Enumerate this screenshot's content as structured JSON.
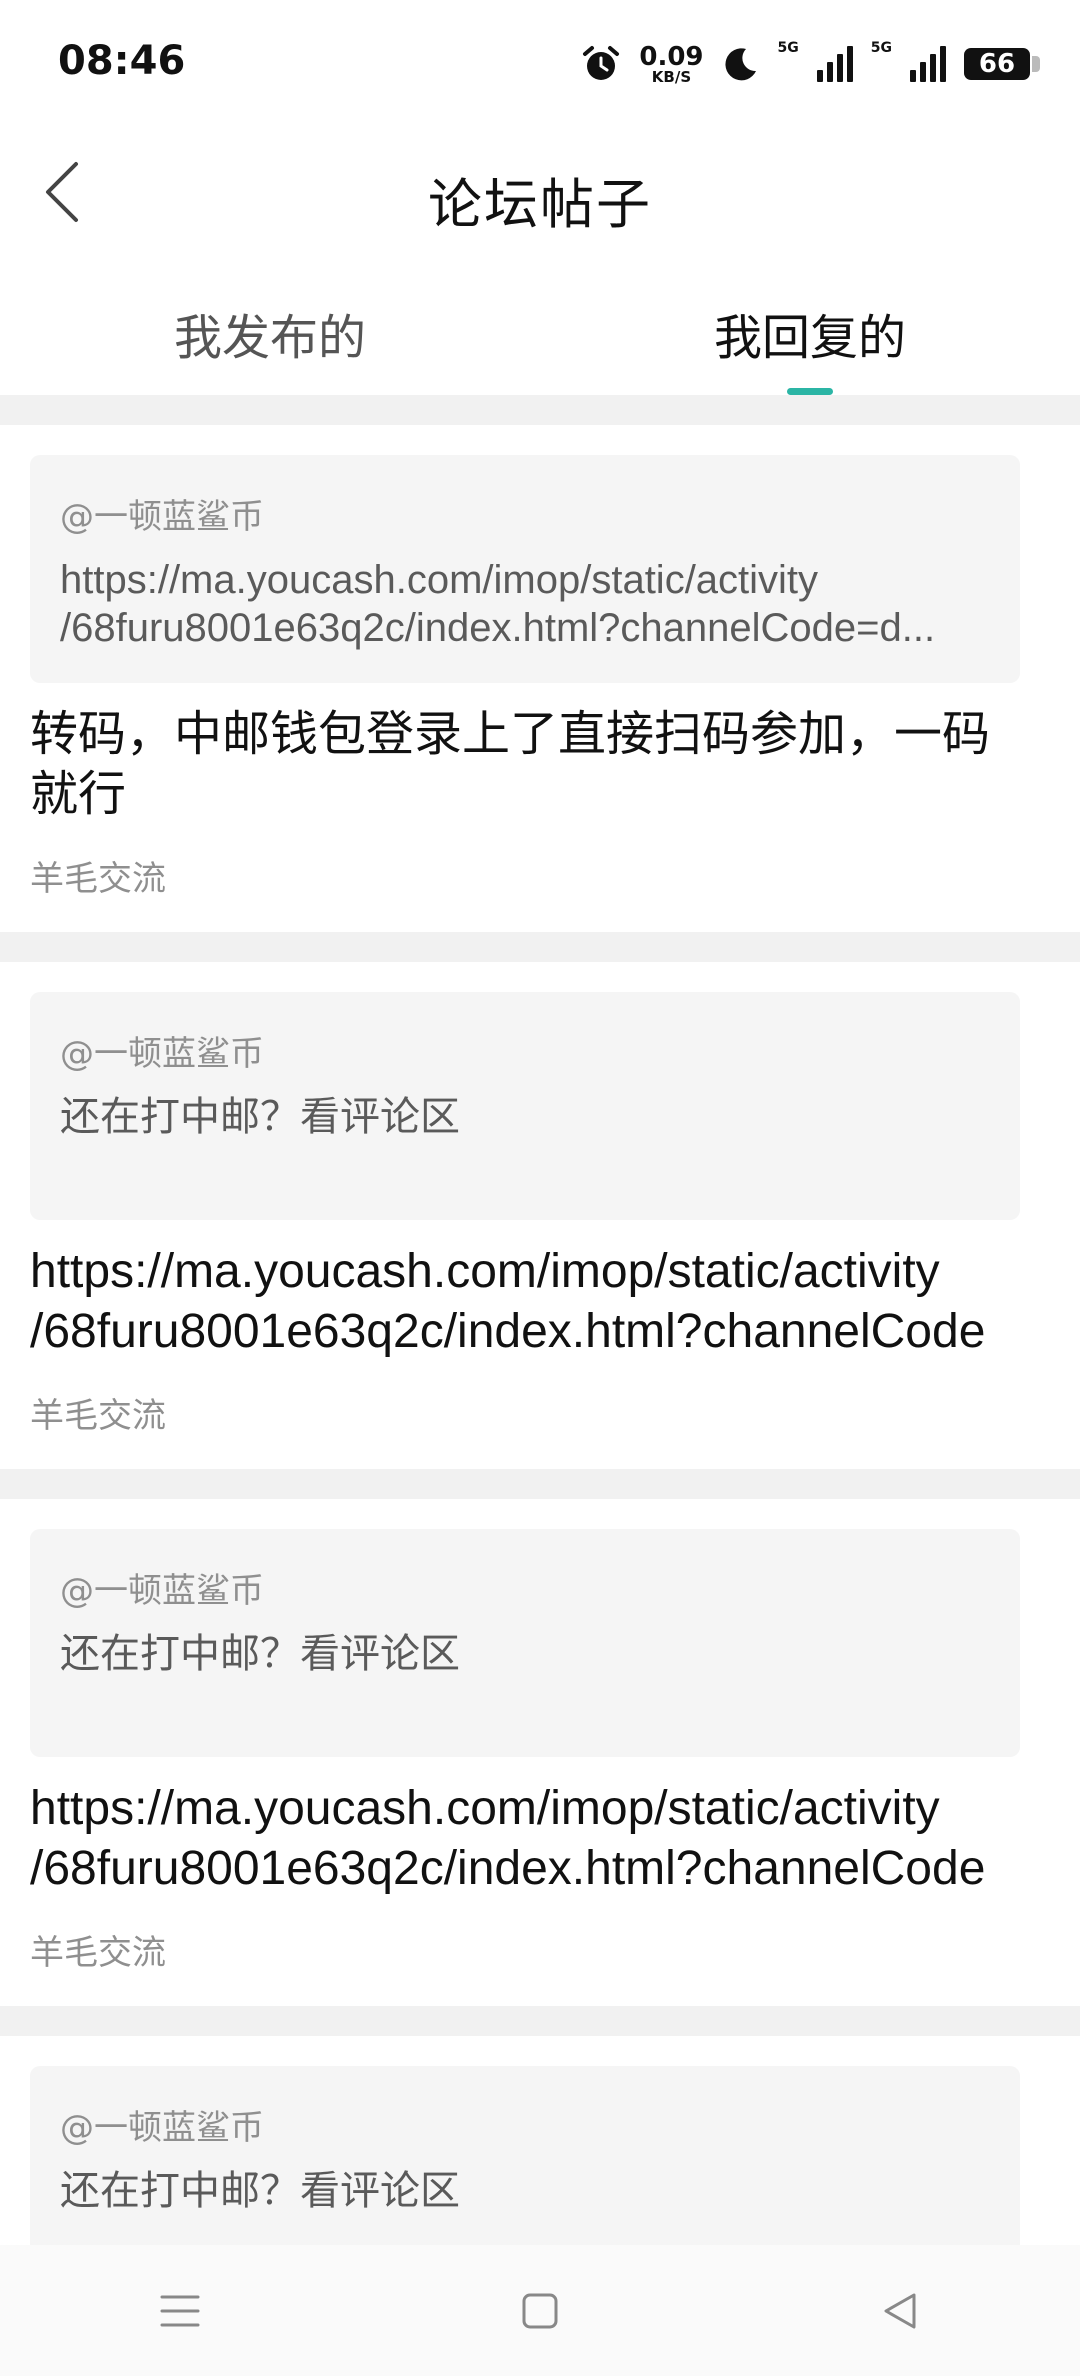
{
  "status_bar": {
    "time": "08:46",
    "net_speed_value": "0.09",
    "net_speed_unit": "KB/S",
    "signal1_label": "5G",
    "signal2_label": "5G",
    "battery": "66"
  },
  "header": {
    "title": "论坛帖子"
  },
  "tabs": [
    {
      "label": "我发布的",
      "active": false
    },
    {
      "label": "我回复的",
      "active": true
    }
  ],
  "posts": [
    {
      "quote_author": "@一顿蓝鲨币",
      "quote_lines": [
        "https://ma.youcash.com/imop/static/activity",
        "/68furu8001e63q2c/index.html?channelCode=d..."
      ],
      "reply_lines": [
        "转码，中邮钱包登录上了直接扫码参加，一码",
        "就行"
      ],
      "category": "羊毛交流"
    },
    {
      "quote_author": "@一顿蓝鲨币",
      "quote_lines": [
        "还在打中邮？看评论区"
      ],
      "reply_lines": [
        "https://ma.youcash.com/imop/static/activity",
        "/68furu8001e63q2c/index.html?channelCode"
      ],
      "category": "羊毛交流"
    },
    {
      "quote_author": "@一顿蓝鲨币",
      "quote_lines": [
        "还在打中邮？看评论区"
      ],
      "reply_lines": [
        "https://ma.youcash.com/imop/static/activity",
        "/68furu8001e63q2c/index.html?channelCode"
      ],
      "category": "羊毛交流"
    },
    {
      "quote_author": "@一顿蓝鲨币",
      "quote_lines": [
        "还在打中邮？看评论区"
      ],
      "reply_lines": [],
      "category": ""
    }
  ],
  "colors": {
    "accent": "#2bb5a5",
    "feed_background": "#f1f1f1",
    "quote_background": "#f5f5f5",
    "muted_text": "#8f8f8f"
  },
  "icons": {
    "back": "chevron-left-icon",
    "alarm": "alarm-icon",
    "moon": "moon-icon",
    "nav_menu": "menu-icon",
    "nav_home": "square-icon",
    "nav_back": "triangle-back-icon"
  }
}
